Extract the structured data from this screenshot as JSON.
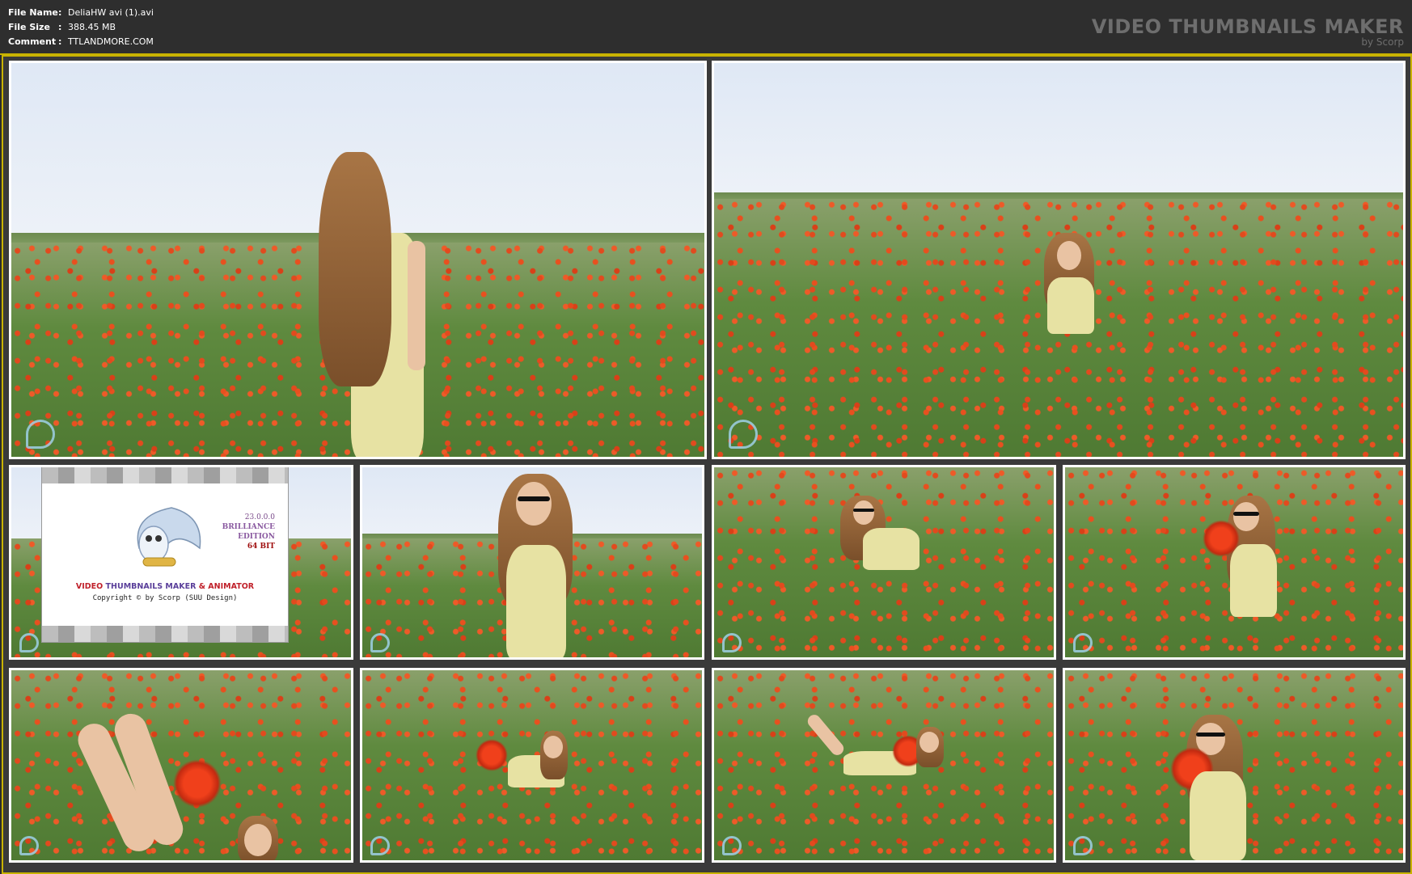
{
  "meta": {
    "file_name_label": "File Name",
    "file_name_value": "DeliaHW avi (1).avi",
    "file_size_label": "File Size",
    "file_size_value": "388.45 MB",
    "comment_label": "Comment",
    "comment_value": "TTLANDMORE.COM",
    "separator": ":"
  },
  "brand": {
    "title": "VIDEO THUMBNAILS MAKER",
    "byline": "by Scorp"
  },
  "splash": {
    "version": "23.0.0.0",
    "edition1": "BRILLIANCE",
    "edition2": "EDITION",
    "bits": "64 BIT",
    "title_part1": "VIDEO",
    "title_part2": "THUMBNAILS MAKER",
    "title_part3": "& ANIMATOR",
    "copyright": "Copyright © by Scorp (SUU Design)"
  },
  "colors": {
    "accent_border": "#c9b300",
    "background": "#2b2b2b",
    "header_text": "#ffffff",
    "brand_text": "#6e6e6e"
  }
}
